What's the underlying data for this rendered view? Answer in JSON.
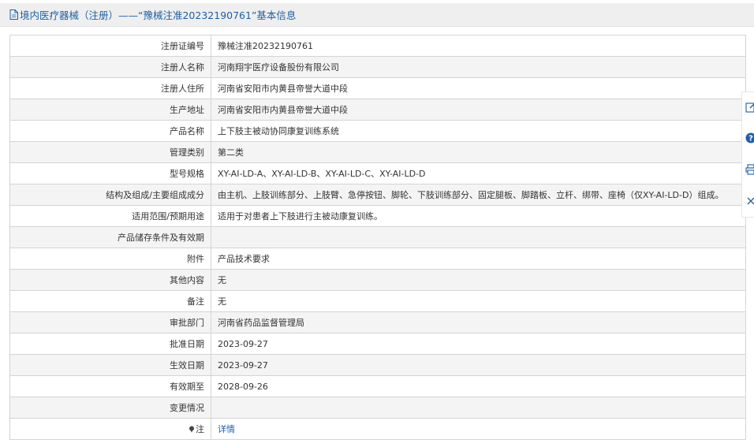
{
  "header": {
    "title": "境内医疗器械（注册）——“豫械注准20232190761”基本信息"
  },
  "rows": [
    {
      "label": "注册证编号",
      "value": "豫械注准20232190761"
    },
    {
      "label": "注册人名称",
      "value": "河南翔宇医疗设备股份有限公司"
    },
    {
      "label": "注册人住所",
      "value": "河南省安阳市内黄县帝誉大道中段"
    },
    {
      "label": "生产地址",
      "value": "河南省安阳市内黄县帝誉大道中段"
    },
    {
      "label": "产品名称",
      "value": "上下肢主被动协同康复训练系统"
    },
    {
      "label": "管理类别",
      "value": "第二类"
    },
    {
      "label": "型号规格",
      "value": "XY-AI-LD-A、XY-AI-LD-B、XY-AI-LD-C、XY-AI-LD-D"
    },
    {
      "label": "结构及组成/主要组成成分",
      "value": "由主机、上肢训练部分、上肢臂、急停按钮、脚轮、下肢训练部分、固定腿板、脚踏板、立杆、绑带、座椅（仅XY-AI-LD-D）组成。"
    },
    {
      "label": "适用范围/预期用途",
      "value": "适用于对患者上下肢进行主被动康复训练。"
    },
    {
      "label": "产品储存条件及有效期",
      "value": ""
    },
    {
      "label": "附件",
      "value": "产品技术要求"
    },
    {
      "label": "其他内容",
      "value": "无"
    },
    {
      "label": "备注",
      "value": "无"
    },
    {
      "label": "审批部门",
      "value": "河南省药品监督管理局"
    },
    {
      "label": "批准日期",
      "value": "2023-09-27"
    },
    {
      "label": "生效日期",
      "value": "2023-09-27"
    },
    {
      "label": "有效期至",
      "value": "2028-09-26"
    },
    {
      "label": "变更情况",
      "value": ""
    }
  ],
  "note_row": {
    "label": "注",
    "link": "详情"
  },
  "icons": {
    "header": "document-icon",
    "note": "pin-icon",
    "side_tools": [
      "edit-icon",
      "help-icon",
      "print-icon",
      "close-icon"
    ]
  },
  "colors": {
    "link": "#1d5fa8",
    "help_badge": "#1d5fa8",
    "header_bg": "#efefef",
    "stripe": "#f4f4f4",
    "border": "#d4d4d4"
  }
}
